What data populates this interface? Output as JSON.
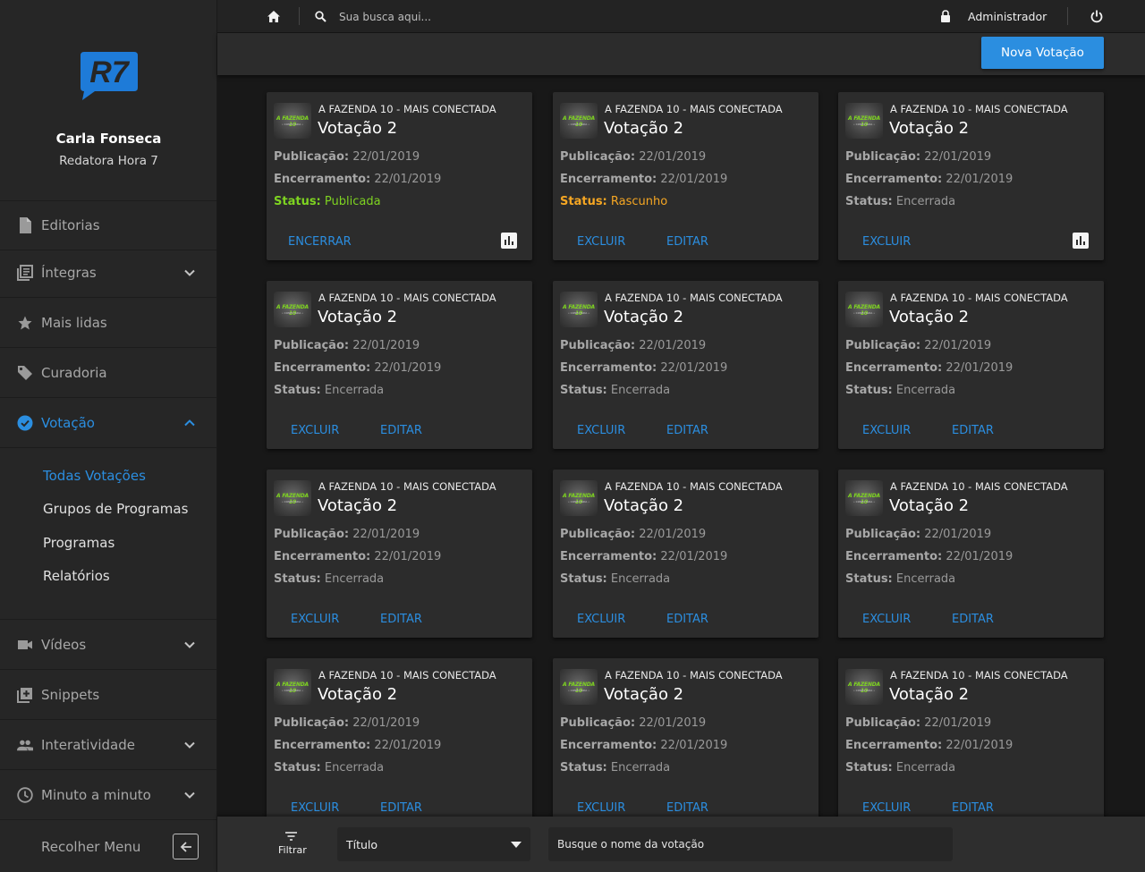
{
  "brand": {
    "logo_text": "R7",
    "logo_color": "#1e7bd8"
  },
  "user": {
    "name": "Carla Fonseca",
    "role": "Redatora Hora 7"
  },
  "sidebar": {
    "items": [
      {
        "label": "Editorias",
        "icon": "document-icon"
      },
      {
        "label": "Íntegras",
        "icon": "library-icon"
      },
      {
        "label": "Mais lidas",
        "icon": "star-icon"
      },
      {
        "label": "Curadoria",
        "icon": "tag-icon"
      },
      {
        "label": "Votação",
        "icon": "check-circle-icon"
      },
      {
        "label": "Vídeos",
        "icon": "video-camera-icon"
      },
      {
        "label": "Snippets",
        "icon": "add-box-icon"
      },
      {
        "label": "Interatividade",
        "icon": "people-icon"
      },
      {
        "label": "Minuto a minuto",
        "icon": "clock-icon"
      }
    ],
    "submenu": [
      "Todas Votações",
      "Grupos de Programas",
      "Programas",
      "Relatórios"
    ],
    "collapse_label": "Recolher Menu"
  },
  "topbar": {
    "search_placeholder": "Sua busca aqui...",
    "user_label": "Administrador"
  },
  "toolbar": {
    "new_button": "Nova Votação"
  },
  "labels": {
    "publication": "Publicação:",
    "closing": "Encerramento:",
    "status": "Status:",
    "close_action": "ENCERRAR",
    "delete_action": "EXCLUIR",
    "edit_action": "EDITAR"
  },
  "thumb": {
    "line1": "A FAZENDA 10",
    "line2": "• CONECTADA •"
  },
  "cards": [
    {
      "program": "A FAZENDA 10 - MAIS CONECTADA",
      "title": "Votação 2",
      "publication": "22/01/2019",
      "closing": "22/01/2019",
      "status": "Publicada"
    },
    {
      "program": "A FAZENDA 10 - MAIS CONECTADA",
      "title": "Votação 2",
      "publication": "22/01/2019",
      "closing": "22/01/2019",
      "status": "Rascunho"
    },
    {
      "program": "A FAZENDA 10 - MAIS CONECTADA",
      "title": "Votação 2",
      "publication": "22/01/2019",
      "closing": "22/01/2019",
      "status": "Encerrada"
    },
    {
      "program": "A FAZENDA 10 - MAIS CONECTADA",
      "title": "Votação 2",
      "publication": "22/01/2019",
      "closing": "22/01/2019",
      "status": "Encerrada"
    },
    {
      "program": "A FAZENDA 10 - MAIS CONECTADA",
      "title": "Votação 2",
      "publication": "22/01/2019",
      "closing": "22/01/2019",
      "status": "Encerrada"
    },
    {
      "program": "A FAZENDA 10 - MAIS CONECTADA",
      "title": "Votação 2",
      "publication": "22/01/2019",
      "closing": "22/01/2019",
      "status": "Encerrada"
    },
    {
      "program": "A FAZENDA 10 - MAIS CONECTADA",
      "title": "Votação 2",
      "publication": "22/01/2019",
      "closing": "22/01/2019",
      "status": "Encerrada"
    },
    {
      "program": "A FAZENDA 10 - MAIS CONECTADA",
      "title": "Votação 2",
      "publication": "22/01/2019",
      "closing": "22/01/2019",
      "status": "Encerrada"
    },
    {
      "program": "A FAZENDA 10 - MAIS CONECTADA",
      "title": "Votação 2",
      "publication": "22/01/2019",
      "closing": "22/01/2019",
      "status": "Encerrada"
    },
    {
      "program": "A FAZENDA 10 - MAIS CONECTADA",
      "title": "Votação 2",
      "publication": "22/01/2019",
      "closing": "22/01/2019",
      "status": "Encerrada"
    },
    {
      "program": "A FAZENDA 10 - MAIS CONECTADA",
      "title": "Votação 2",
      "publication": "22/01/2019",
      "closing": "22/01/2019",
      "status": "Encerrada"
    },
    {
      "program": "A FAZENDA 10 - MAIS CONECTADA",
      "title": "Votação 2",
      "publication": "22/01/2019",
      "closing": "22/01/2019",
      "status": "Encerrada"
    }
  ],
  "filter": {
    "label": "Filtrar",
    "select_value": "Título",
    "search_placeholder": "Busque o nome da votação"
  },
  "colors": {
    "accent": "#2b8ee0",
    "published": "#7ed321",
    "draft": "#f5a623"
  }
}
